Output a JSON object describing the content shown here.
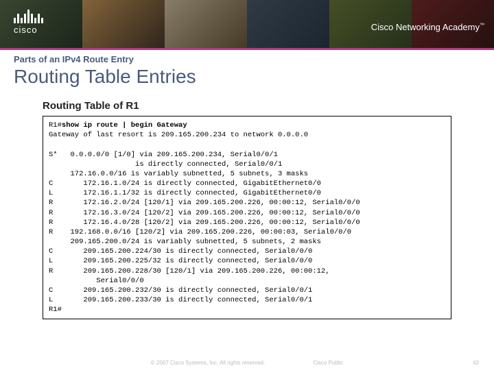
{
  "header": {
    "logo_text": "cisco",
    "academy_text": "Cisco Networking Academy",
    "academy_tm": "™"
  },
  "kicker": "Parts of an IPv4 Route Entry",
  "title": "Routing Table Entries",
  "routing_table_title": "Routing Table of R1",
  "terminal": {
    "prompt1": "R1#",
    "cmd": "show ip route | begin Gateway",
    "lines": [
      "Gateway of last resort is 209.165.200.234 to network 0.0.0.0",
      "",
      "S*   0.0.0.0/0 [1/0] via 209.165.200.234, Serial0/0/1",
      "                    is directly connected, Serial0/0/1",
      "     172.16.0.0/16 is variably subnetted, 5 subnets, 3 masks",
      "C       172.16.1.0/24 is directly connected, GigabitEthernet0/0",
      "L       172.16.1.1/32 is directly connected, GigabitEthernet0/0",
      "R       172.16.2.0/24 [120/1] via 209.165.200.226, 00:00:12, Serial0/0/0",
      "R       172.16.3.0/24 [120/2] via 209.165.200.226, 00:00:12, Serial0/0/0",
      "R       172.16.4.0/28 [120/2] via 209.165.200.226, 00:00:12, Serial0/0/0",
      "R    192.168.0.0/16 [120/2] via 209.165.200.226, 00:00:03, Serial0/0/0",
      "     209.165.200.0/24 is variably subnetted, 5 subnets, 2 masks",
      "C       209.165.200.224/30 is directly connected, Serial0/0/0",
      "L       209.165.200.225/32 is directly connected, Serial0/0/0",
      "R       209.165.200.228/30 [120/1] via 209.165.200.226, 00:00:12,",
      "           Serial0/0/0",
      "C       209.165.200.232/30 is directly connected, Serial0/0/1",
      "L       209.165.200.233/30 is directly connected, Serial0/0/1"
    ],
    "prompt2": "R1#"
  },
  "footer": {
    "copyright": "© 2007 Cisco Systems, Inc. All rights reserved.",
    "classification": "Cisco Public",
    "page": "43"
  }
}
